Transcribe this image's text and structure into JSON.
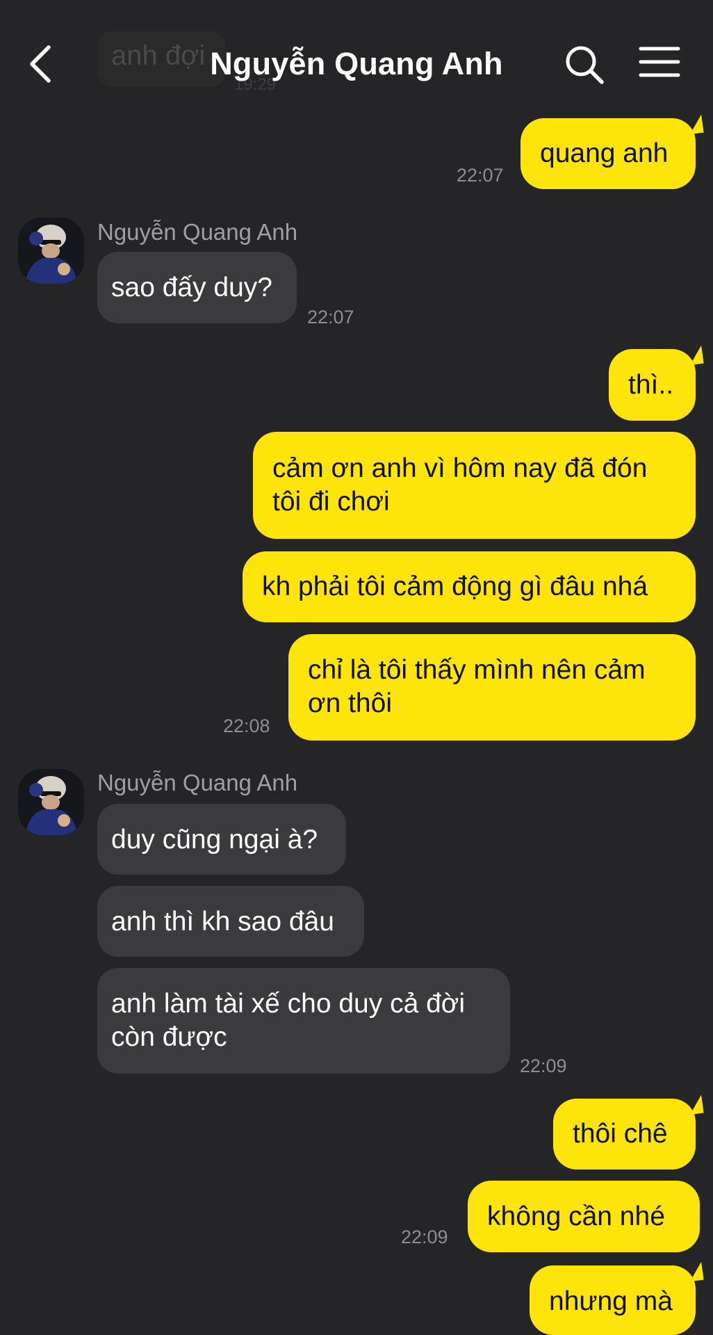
{
  "header": {
    "title": "Nguyễn Quang Anh",
    "ghost_message": "anh đợi",
    "ghost_time": "19:29"
  },
  "messages": {
    "m1": {
      "text": "quang anh",
      "time": "22:07"
    },
    "g1": {
      "sender": "Nguyễn Quang Anh",
      "text": "sao đấy duy?",
      "time": "22:07"
    },
    "m2": "thì..",
    "m3": {
      "line1": "cảm ơn anh vì hôm nay đã đón",
      "line2": "tôi đi chơi"
    },
    "m4": "kh phải tôi cảm động gì đâu nhá",
    "m5": {
      "line1": "chỉ là tôi thấy mình nên cảm",
      "line2": "ơn thôi",
      "time": "22:08"
    },
    "g2": {
      "sender": "Nguyễn Quang Anh",
      "text1": "duy cũng ngại à?",
      "text2": "anh thì kh sao đâu",
      "text3_line1": "anh làm tài xế cho duy cả đời",
      "text3_line2": "còn được",
      "time": "22:09"
    },
    "m6": "thôi chê",
    "m7": {
      "text": "không cần nhé",
      "time": "22:09"
    },
    "m8": "nhưng mà"
  },
  "colors": {
    "background": "#252527",
    "outgoing_bubble": "#fde40b",
    "incoming_bubble": "#3b3b3d"
  },
  "icons": [
    "back-arrow-icon",
    "search-icon",
    "menu-icon",
    "avatar"
  ]
}
